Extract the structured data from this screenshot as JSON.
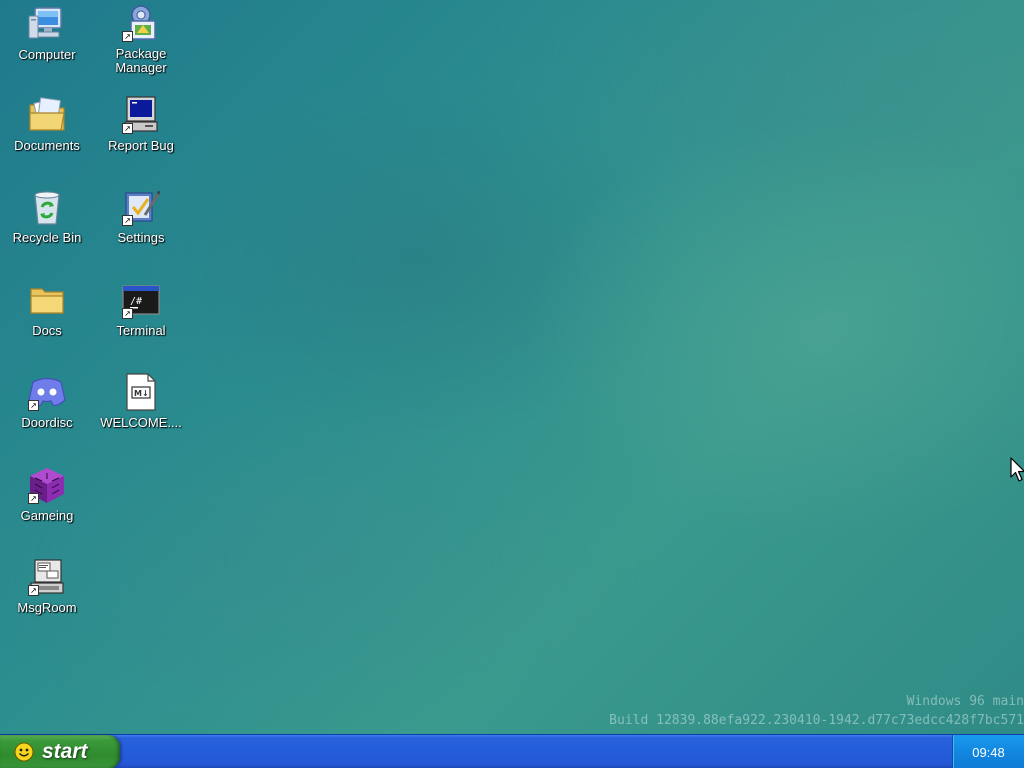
{
  "desktop": {
    "icons": [
      {
        "label": "Computer",
        "icon": "computer-icon"
      },
      {
        "label": "Package\nManager",
        "icon": "package-manager-icon"
      },
      {
        "label": "Documents",
        "icon": "documents-folder-icon"
      },
      {
        "label": "Report Bug",
        "icon": "report-bug-icon"
      },
      {
        "label": "Recycle Bin",
        "icon": "recycle-bin-icon"
      },
      {
        "label": "Settings",
        "icon": "settings-icon"
      },
      {
        "label": "Docs",
        "icon": "folder-icon"
      },
      {
        "label": "Terminal",
        "icon": "terminal-icon"
      },
      {
        "label": "Doordisc",
        "icon": "doordisc-icon"
      },
      {
        "label": "WELCOME....",
        "icon": "markdown-file-icon"
      },
      {
        "label": "Gameing",
        "icon": "gameing-cube-icon"
      },
      {
        "label": "MsgRoom",
        "icon": "msgroom-icon"
      }
    ]
  },
  "watermark": {
    "line1": "Windows 96 main",
    "line2": "Build 12839.88efa922.230410-1942.d77c73edcc428f7bc571"
  },
  "taskbar": {
    "start_label": "start",
    "clock": "09:48"
  },
  "colors": {
    "taskbar_blue": "#245ddb",
    "start_green": "#2f8c2e",
    "tray_blue": "#1287e0",
    "desktop_teal": "#2a8c8f"
  }
}
